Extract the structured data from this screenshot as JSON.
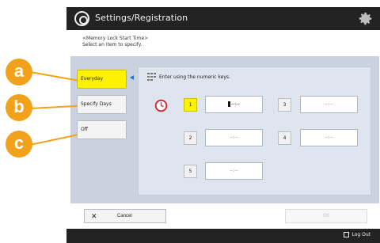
{
  "header": {
    "title": "Settings/Registration",
    "logo_icon": "gear-logo-icon",
    "settings_icon": "gear-icon"
  },
  "instructions": {
    "line1": "<Memory Lock Start Time>",
    "line2": "Select an item to specify."
  },
  "options": [
    {
      "label": "Everyday",
      "selected": true
    },
    {
      "label": "Specify Days",
      "selected": false
    },
    {
      "label": "Off",
      "selected": false
    }
  ],
  "hint": "Enter using the numeric keys.",
  "time_slots": [
    {
      "number": "1",
      "value": "--:--",
      "active": true
    },
    {
      "number": "2",
      "value": "--:--",
      "active": false
    },
    {
      "number": "3",
      "value": "--:--",
      "active": false
    },
    {
      "number": "4",
      "value": "--:--",
      "active": false
    },
    {
      "number": "5",
      "value": "--:--",
      "active": false
    }
  ],
  "footer": {
    "cancel_label": "Cancel",
    "ok_label": "OK",
    "logout_label": "Log Out"
  },
  "callouts": [
    "a",
    "b",
    "c"
  ],
  "colors": {
    "accent_yellow": "#fff200",
    "callout_orange": "#f2a21a",
    "panel_bg": "#c9d2de",
    "bar_bg": "#232323"
  }
}
